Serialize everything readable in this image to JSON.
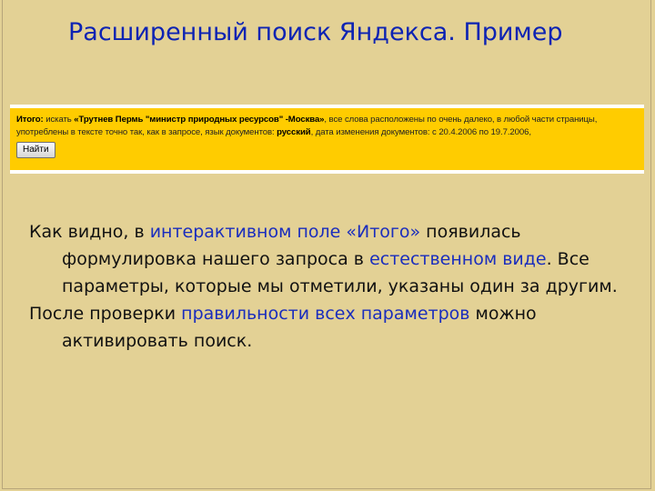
{
  "slide": {
    "title": "Расширенный поиск Яндекса. Пример"
  },
  "screenshot": {
    "summary_label": "Итого:",
    "summary_pre": " искать ",
    "summary_query": "«Трутнев Пермь \"министр природных ресурсов\" -Москва»",
    "summary_mid": ", все слова расположены по очень далеко, в любой части страницы, употреблены в тексте точно так, как в запросе, язык документов: ",
    "summary_language": "русский",
    "summary_post": ", дата изменения документов: с 20.4.2006 по 19.7.2006,",
    "find_button_label": "Найти"
  },
  "body": {
    "p1_a": "Как видно, в ",
    "p1_hl1": "интерактивном поле «Итого»",
    "p1_b": " появилась формулировка нашего запроса в ",
    "p1_hl2": "естественном виде",
    "p1_c": ". Все параметры, которые мы отметили, указаны один за другим.",
    "p2_a": "После проверки ",
    "p2_hl1": "правильности всех параметров",
    "p2_b": " можно активировать поиск."
  },
  "colors": {
    "background": "#e3d195",
    "title": "#0d23b3",
    "highlight": "#1a2dbd",
    "panel": "#ffcc00"
  }
}
